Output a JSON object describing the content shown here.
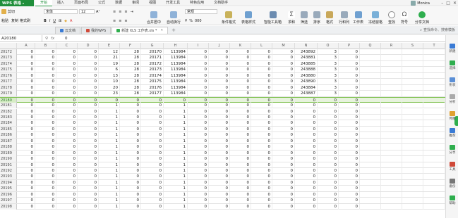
{
  "app": {
    "name": "WPS 表格",
    "user": "Monica"
  },
  "menu": [
    "开始",
    "插入",
    "页面布局",
    "公式",
    "数据",
    "审阅",
    "视图",
    "开发工具",
    "特色应用",
    "文档助手"
  ],
  "menu_active_index": 0,
  "ribbon": {
    "cut": "剪切",
    "paste": "粘贴",
    "copy": "复制",
    "format_painter": "格式刷",
    "font_name": "宋体",
    "font_size": "12",
    "merge_center": "合并居中",
    "wrap_text": "自动换行",
    "number_format": "常规",
    "cond_format": "条件格式",
    "table_style": "表格样式",
    "smart_toolbox": "智能工具箱",
    "sum": "求和",
    "filter": "筛选",
    "sort": "排序",
    "format": "格式",
    "row_col": "行和列",
    "worksheet": "工作表",
    "freeze": "冻结窗格",
    "find": "查找",
    "symbol": "符号",
    "share": "分享文档"
  },
  "tabs": [
    {
      "label": "云文档",
      "icon": "cloud-icon"
    },
    {
      "label": "我的WPS",
      "icon": "wps-icon"
    },
    {
      "label": "新建 XLS 工作表.xls *",
      "icon": "sheet-icon",
      "active": true
    }
  ],
  "search_placeholder": "查找命令、搜索模板",
  "formula_bar": {
    "cell_ref": "A20180",
    "value": "0"
  },
  "columns": [
    "A",
    "B",
    "C",
    "D",
    "E",
    "F",
    "G",
    "H",
    "I",
    "J",
    "K",
    "L",
    "M",
    "N",
    "O",
    "P",
    "Q",
    "R",
    "S",
    "T"
  ],
  "rows": [
    {
      "num": "20172",
      "cells": [
        "0",
        "0",
        "0",
        "0",
        "12",
        "28",
        "20170",
        "113984",
        "0",
        "0",
        "0",
        "0",
        "0",
        "243892",
        "3",
        "0"
      ]
    },
    {
      "num": "20173",
      "cells": [
        "0",
        "0",
        "0",
        "0",
        "21",
        "28",
        "20171",
        "113984",
        "0",
        "0",
        "0",
        "0",
        "0",
        "243881",
        "3",
        "0"
      ]
    },
    {
      "num": "20174",
      "cells": [
        "0",
        "0",
        "0",
        "0",
        "19",
        "28",
        "20172",
        "113984",
        "0",
        "0",
        "0",
        "0",
        "0",
        "243885",
        "3",
        "0"
      ]
    },
    {
      "num": "20175",
      "cells": [
        "0",
        "0",
        "0",
        "0",
        "6",
        "28",
        "20173",
        "113984",
        "0",
        "0",
        "0",
        "0",
        "0",
        "243888",
        "3",
        "0"
      ]
    },
    {
      "num": "20176",
      "cells": [
        "0",
        "0",
        "0",
        "0",
        "13",
        "28",
        "20174",
        "113984",
        "0",
        "0",
        "0",
        "0",
        "0",
        "243880",
        "3",
        "0"
      ]
    },
    {
      "num": "20177",
      "cells": [
        "0",
        "0",
        "0",
        "0",
        "10",
        "28",
        "20175",
        "113984",
        "0",
        "0",
        "0",
        "0",
        "0",
        "243890",
        "3",
        "0"
      ]
    },
    {
      "num": "20178",
      "cells": [
        "0",
        "0",
        "0",
        "0",
        "20",
        "28",
        "20176",
        "113984",
        "0",
        "0",
        "0",
        "0",
        "0",
        "243884",
        "3",
        "0"
      ]
    },
    {
      "num": "20179",
      "cells": [
        "0",
        "0",
        "0",
        "0",
        "23",
        "28",
        "20177",
        "113984",
        "0",
        "0",
        "0",
        "0",
        "0",
        "243887",
        "3",
        "0"
      ]
    },
    {
      "num": "20180",
      "cells": [
        "0",
        "0",
        "0",
        "0",
        "0",
        "0",
        "0",
        "0",
        "0",
        "0",
        "0",
        "0",
        "0",
        "0",
        "0",
        "0"
      ],
      "selected": true
    },
    {
      "num": "20181",
      "cells": [
        "0",
        "0",
        "0",
        "0",
        "1",
        "0",
        "0",
        "1",
        "0",
        "0",
        "0",
        "0",
        "0",
        "0",
        "0",
        "0"
      ]
    },
    {
      "num": "20182",
      "cells": [
        "0",
        "0",
        "0",
        "0",
        "1",
        "0",
        "0",
        "1",
        "0",
        "0",
        "0",
        "0",
        "0",
        "0",
        "0",
        "0"
      ]
    },
    {
      "num": "20183",
      "cells": [
        "0",
        "0",
        "0",
        "0",
        "1",
        "0",
        "0",
        "1",
        "0",
        "0",
        "0",
        "0",
        "0",
        "0",
        "0",
        "0"
      ]
    },
    {
      "num": "20184",
      "cells": [
        "0",
        "0",
        "0",
        "0",
        "1",
        "0",
        "0",
        "1",
        "0",
        "0",
        "0",
        "0",
        "0",
        "0",
        "0",
        "0"
      ]
    },
    {
      "num": "20185",
      "cells": [
        "0",
        "0",
        "0",
        "0",
        "1",
        "0",
        "0",
        "1",
        "0",
        "0",
        "0",
        "0",
        "0",
        "0",
        "0",
        "0"
      ]
    },
    {
      "num": "20186",
      "cells": [
        "0",
        "0",
        "0",
        "0",
        "1",
        "0",
        "0",
        "1",
        "0",
        "0",
        "0",
        "0",
        "0",
        "0",
        "0",
        "0"
      ]
    },
    {
      "num": "20187",
      "cells": [
        "0",
        "0",
        "0",
        "0",
        "1",
        "0",
        "0",
        "1",
        "0",
        "0",
        "0",
        "0",
        "0",
        "0",
        "0",
        "0"
      ]
    },
    {
      "num": "20188",
      "cells": [
        "0",
        "0",
        "0",
        "0",
        "1",
        "0",
        "0",
        "1",
        "0",
        "0",
        "0",
        "0",
        "0",
        "0",
        "0",
        "0"
      ]
    },
    {
      "num": "20189",
      "cells": [
        "0",
        "0",
        "0",
        "0",
        "1",
        "0",
        "0",
        "1",
        "0",
        "0",
        "0",
        "0",
        "0",
        "0",
        "0",
        "0"
      ]
    },
    {
      "num": "20190",
      "cells": [
        "0",
        "0",
        "0",
        "0",
        "1",
        "0",
        "0",
        "1",
        "0",
        "0",
        "0",
        "0",
        "0",
        "0",
        "0",
        "0"
      ]
    },
    {
      "num": "20191",
      "cells": [
        "0",
        "0",
        "0",
        "0",
        "1",
        "0",
        "0",
        "1",
        "0",
        "0",
        "0",
        "0",
        "0",
        "0",
        "0",
        "0"
      ]
    },
    {
      "num": "20192",
      "cells": [
        "0",
        "0",
        "0",
        "0",
        "1",
        "0",
        "0",
        "1",
        "0",
        "0",
        "0",
        "0",
        "0",
        "0",
        "0",
        "0"
      ]
    },
    {
      "num": "20193",
      "cells": [
        "0",
        "0",
        "0",
        "0",
        "1",
        "0",
        "0",
        "1",
        "0",
        "0",
        "0",
        "0",
        "0",
        "0",
        "0",
        "0"
      ]
    },
    {
      "num": "20194",
      "cells": [
        "0",
        "0",
        "0",
        "0",
        "1",
        "0",
        "0",
        "1",
        "0",
        "0",
        "0",
        "0",
        "0",
        "0",
        "0",
        "0"
      ]
    },
    {
      "num": "20195",
      "cells": [
        "0",
        "0",
        "0",
        "0",
        "1",
        "0",
        "0",
        "1",
        "0",
        "0",
        "0",
        "0",
        "0",
        "0",
        "0",
        "0"
      ]
    },
    {
      "num": "20196",
      "cells": [
        "0",
        "0",
        "0",
        "0",
        "1",
        "0",
        "0",
        "1",
        "0",
        "0",
        "0",
        "0",
        "0",
        "0",
        "0",
        "0"
      ]
    },
    {
      "num": "20197",
      "cells": [
        "0",
        "0",
        "0",
        "0",
        "1",
        "0",
        "0",
        "1",
        "0",
        "0",
        "0",
        "0",
        "0",
        "0",
        "0",
        "0"
      ]
    },
    {
      "num": "20198",
      "cells": [
        "0",
        "0",
        "0",
        "0",
        "1",
        "0",
        "0",
        "1",
        "0",
        "0",
        "0",
        "0",
        "0",
        "0",
        "0",
        "0"
      ]
    }
  ],
  "side_panel": [
    {
      "label": "新建",
      "color": "#3a7bd5"
    },
    {
      "label": "选择",
      "color": "#2fae4e"
    },
    {
      "label": "形状",
      "color": "#5b8fd6"
    },
    {
      "label": "分析",
      "color": "#aaaaaa"
    },
    {
      "label": "传图",
      "color": "#e0a030"
    },
    {
      "label": "推荐",
      "color": "#3a7bd5"
    },
    {
      "label": "分享",
      "color": "#2fae4e"
    },
    {
      "label": "工具",
      "color": "#d04a3a"
    },
    {
      "label": "备份",
      "color": "#777777"
    },
    {
      "label": "帮助",
      "color": "#2fae4e"
    }
  ],
  "colors": {
    "accent": "#1f8f3a",
    "selected_row": "#e7f3dd"
  }
}
